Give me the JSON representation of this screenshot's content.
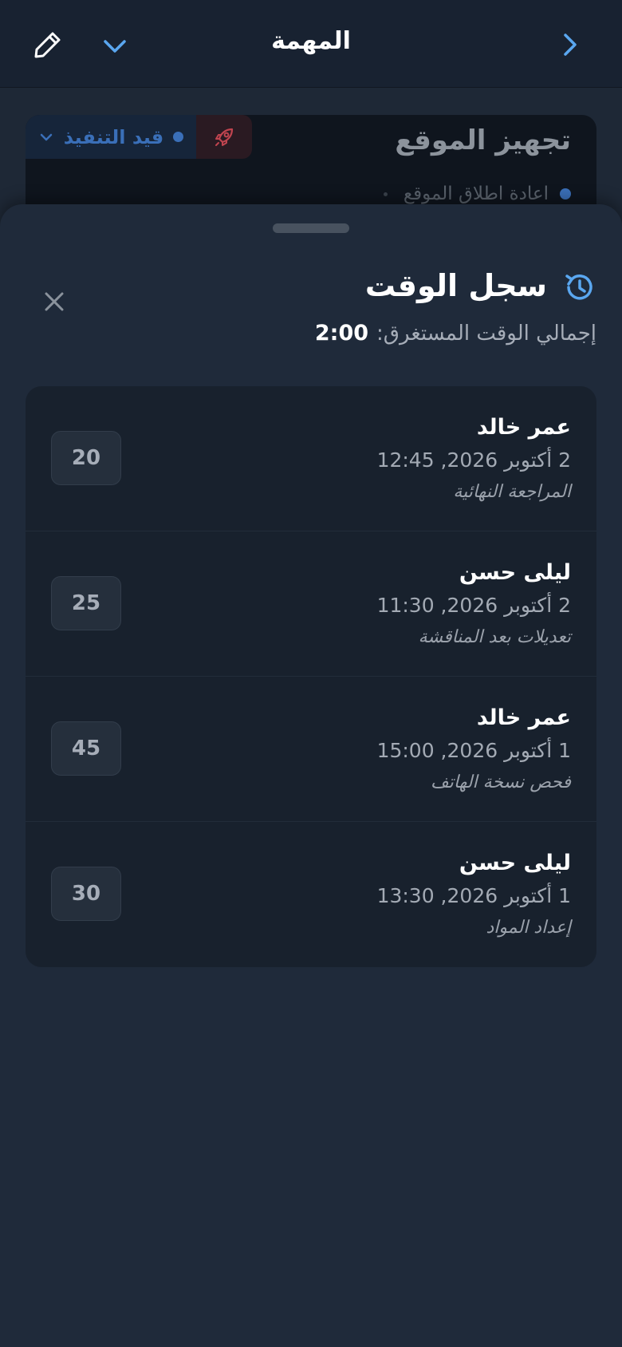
{
  "topbar": {
    "title": "المهمة"
  },
  "task": {
    "title": "تجهيز الموقع",
    "status": "قيد التنفيذ",
    "subtask": "اعادة اطلاق الموقع"
  },
  "sheet": {
    "title": "سجل الوقت",
    "total_label": "إجمالي الوقت المستغرق:",
    "total_value": "2:00"
  },
  "entries": [
    {
      "name": "عمر خالد",
      "when": "2 أكتوبر 2026, 12:45",
      "note": "المراجعة النهائية",
      "minutes": "20"
    },
    {
      "name": "ليلى حسن",
      "when": "2 أكتوبر 2026, 11:30",
      "note": "تعديلات بعد المناقشة",
      "minutes": "25"
    },
    {
      "name": "عمر خالد",
      "when": "1 أكتوبر 2026, 15:00",
      "note": "فحص نسخة الهاتف",
      "minutes": "45"
    },
    {
      "name": "ليلى حسن",
      "when": "1 أكتوبر 2026, 13:30",
      "note": "إعداد المواد",
      "minutes": "30"
    }
  ],
  "colors": {
    "accent": "#5aa7f0",
    "status_blue": "#3a6fb8",
    "priority_red": "#c0444f",
    "sheet_bg": "#1f2a3a",
    "list_bg": "#18212d"
  },
  "icons": {
    "back": "chevron-right-icon",
    "menu": "chevron-down-icon",
    "edit": "pencil-icon",
    "priority": "rocket-icon",
    "history": "history-icon",
    "close": "close-icon"
  }
}
